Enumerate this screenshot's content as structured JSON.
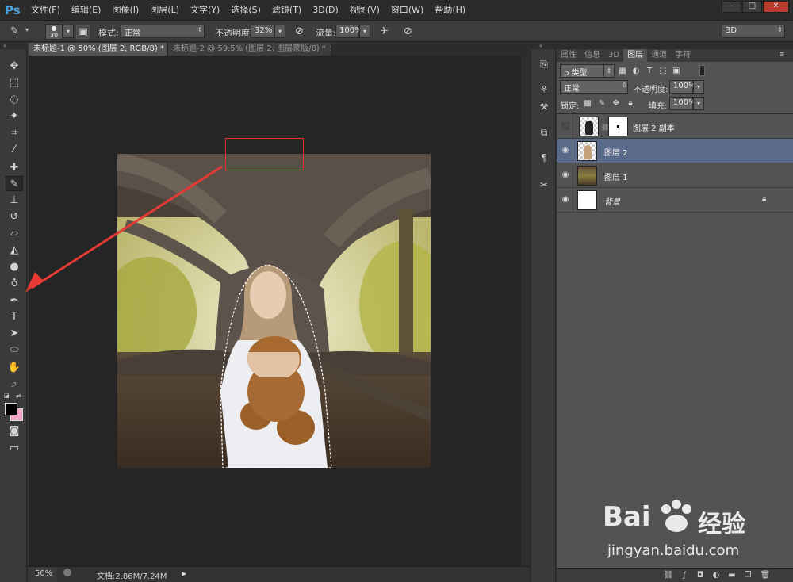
{
  "menubar": {
    "logo": "Ps",
    "items": [
      "文件(F)",
      "编辑(E)",
      "图像(I)",
      "图层(L)",
      "文字(Y)",
      "选择(S)",
      "滤镜(T)",
      "3D(D)",
      "视图(V)",
      "窗口(W)",
      "帮助(H)"
    ],
    "window_controls": [
      "–",
      "□",
      "✕"
    ]
  },
  "options": {
    "brush_size": "30",
    "mode_label": "模式:",
    "mode_value": "正常",
    "opacity_label": "不透明度:",
    "opacity_value": "32%",
    "flow_label": "流量:",
    "flow_value": "100%",
    "workspace": "3D"
  },
  "doc_tabs": [
    {
      "label": "未标题-1 @ 50% (图层 2, RGB/8) *",
      "close": "×"
    },
    {
      "label": "未标题-2 @ 59.5% (图层 2, 图层蒙版/8) *",
      "close": "×"
    }
  ],
  "status": {
    "zoom": "50%",
    "doc_info": "文档:2.86M/7.24M"
  },
  "panel": {
    "tabs": [
      "属性",
      "信息",
      "3D",
      "图层",
      "通道",
      "字符"
    ],
    "active_tab": "图层",
    "filter_kind": "ρ 类型",
    "blend_mode": "正常",
    "opacity_label": "不透明度:",
    "opacity_value": "100%",
    "lock_label": "锁定:",
    "fill_label": "填充:",
    "fill_value": "100%",
    "layers": [
      {
        "name": "图层 2 副本",
        "visible": false,
        "selected": false
      },
      {
        "name": "图层 2",
        "visible": true,
        "selected": true
      },
      {
        "name": "图层 1",
        "visible": true,
        "selected": false
      },
      {
        "name": "背景",
        "visible": true,
        "selected": false
      }
    ]
  },
  "watermark": {
    "brand": "Bai",
    "brand_suffix": "经验",
    "url": "jingyan.baidu.com"
  }
}
